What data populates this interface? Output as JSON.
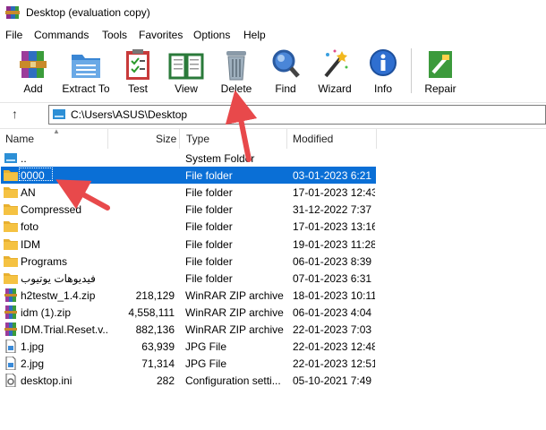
{
  "window": {
    "title": "Desktop (evaluation copy)"
  },
  "menu": [
    "File",
    "Commands",
    "Tools",
    "Favorites",
    "Options",
    "Help"
  ],
  "toolbar": {
    "add": "Add",
    "extract": "Extract To",
    "test": "Test",
    "view": "View",
    "delete": "Delete",
    "find": "Find",
    "wizard": "Wizard",
    "info": "Info",
    "repair": "Repair"
  },
  "address": {
    "path": "C:\\Users\\ASUS\\Desktop"
  },
  "columns": {
    "name": "Name",
    "size": "Size",
    "type": "Type",
    "modified": "Modified"
  },
  "files": [
    {
      "name": "..",
      "size": "",
      "type": "System Folder",
      "modified": "",
      "icon": "drive-icon"
    },
    {
      "name": "0000",
      "size": "",
      "type": "File folder",
      "modified": "03-01-2023 6:21",
      "icon": "folder-icon",
      "selected": true
    },
    {
      "name": "AN",
      "size": "",
      "type": "File folder",
      "modified": "17-01-2023 12:43",
      "icon": "folder-icon"
    },
    {
      "name": "Compressed",
      "size": "",
      "type": "File folder",
      "modified": "31-12-2022 7:37",
      "icon": "folder-icon"
    },
    {
      "name": "foto",
      "size": "",
      "type": "File folder",
      "modified": "17-01-2023 13:16",
      "icon": "folder-icon"
    },
    {
      "name": "IDM",
      "size": "",
      "type": "File folder",
      "modified": "19-01-2023 11:28",
      "icon": "folder-icon"
    },
    {
      "name": "Programs",
      "size": "",
      "type": "File folder",
      "modified": "06-01-2023 8:39",
      "icon": "folder-icon"
    },
    {
      "name": "فيديوهات يوتيوب",
      "size": "",
      "type": "File folder",
      "modified": "07-01-2023 6:31",
      "icon": "folder-icon"
    },
    {
      "name": "h2testw_1.4.zip",
      "size": "218,129",
      "type": "WinRAR ZIP archive",
      "modified": "18-01-2023 10:11",
      "icon": "rar-icon"
    },
    {
      "name": "idm (1).zip",
      "size": "4,558,111",
      "type": "WinRAR ZIP archive",
      "modified": "06-01-2023 4:04",
      "icon": "rar-icon"
    },
    {
      "name": "IDM.Trial.Reset.v...",
      "size": "882,136",
      "type": "WinRAR ZIP archive",
      "modified": "22-01-2023 7:03",
      "icon": "rar-icon"
    },
    {
      "name": "1.jpg",
      "size": "63,939",
      "type": "JPG File",
      "modified": "22-01-2023 12:48",
      "icon": "image-file-icon"
    },
    {
      "name": "2.jpg",
      "size": "71,314",
      "type": "JPG File",
      "modified": "22-01-2023 12:51",
      "icon": "image-file-icon"
    },
    {
      "name": "desktop.ini",
      "size": "282",
      "type": "Configuration setti...",
      "modified": "05-10-2021 7:49",
      "icon": "settings-file-icon"
    }
  ],
  "colors": {
    "selection": "#0a6fd6",
    "annotation_arrow": "#e8494b",
    "folder": "#f5c242"
  }
}
